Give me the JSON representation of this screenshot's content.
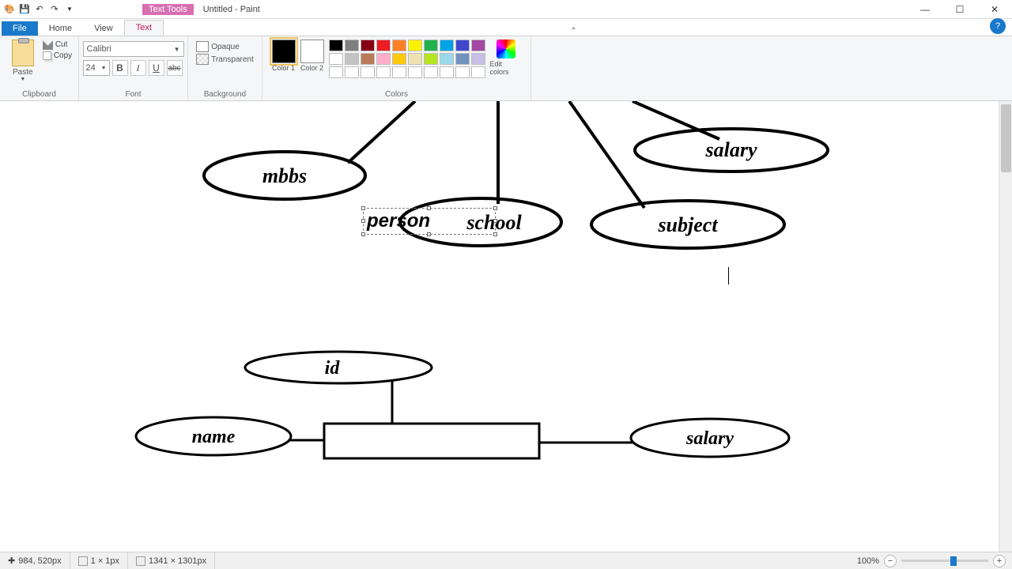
{
  "title": {
    "text_tools": "Text Tools",
    "file": "Untitled - Paint"
  },
  "tabs": {
    "file": "File",
    "home": "Home",
    "view": "View",
    "text": "Text"
  },
  "ribbon": {
    "clipboard": {
      "label": "Clipboard",
      "paste": "Paste",
      "cut": "Cut",
      "copy": "Copy"
    },
    "font": {
      "label": "Font",
      "family": "Calibri",
      "size": "24"
    },
    "background": {
      "label": "Background",
      "opaque": "Opaque",
      "transparent": "Transparent"
    },
    "colors": {
      "label": "Colors",
      "color1": "Color 1",
      "color2": "Color 2",
      "edit": "Edit colors"
    }
  },
  "canvas": {
    "shapes": {
      "mbbs": "mbbs",
      "person": "person",
      "school": "school",
      "subject": "subject",
      "salary1": "salary",
      "id": "id",
      "name": "name",
      "salary2": "salary"
    }
  },
  "status": {
    "pos": "984, 520px",
    "sel": "1 × 1px",
    "size": "1341 × 1301px",
    "zoom": "100%"
  },
  "palette": {
    "row1": [
      "#000000",
      "#7f7f7f",
      "#880015",
      "#ed1c24",
      "#ff7f27",
      "#fff200",
      "#22b14c",
      "#00a2e8",
      "#3f48cc",
      "#a349a4"
    ],
    "row2": [
      "#ffffff",
      "#c3c3c3",
      "#b97a57",
      "#ffaec9",
      "#ffc90e",
      "#efe4b0",
      "#b5e61d",
      "#99d9ea",
      "#7092be",
      "#c8bfe7"
    ],
    "row3": [
      "#ffffff",
      "#ffffff",
      "#ffffff",
      "#ffffff",
      "#ffffff",
      "#ffffff",
      "#ffffff",
      "#ffffff",
      "#ffffff",
      "#ffffff"
    ]
  }
}
